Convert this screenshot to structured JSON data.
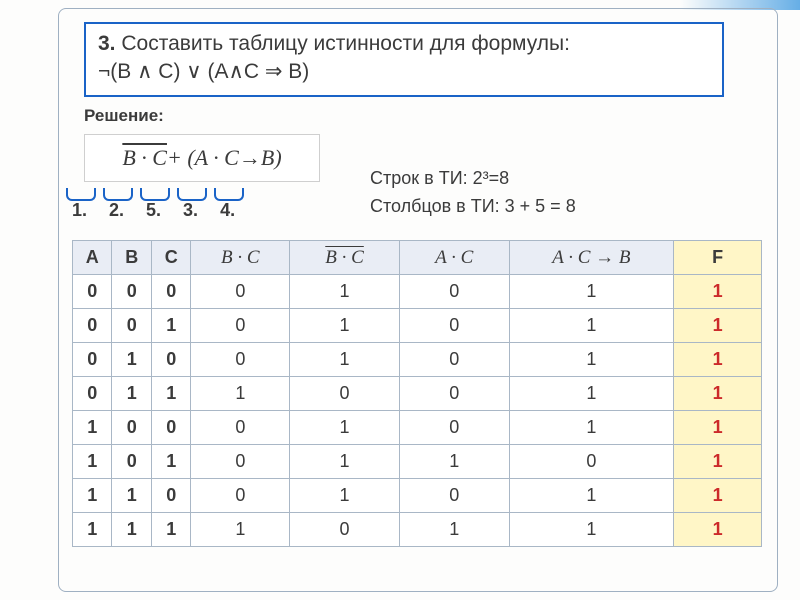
{
  "task": {
    "number_label": "3.",
    "text_line1": "Составить таблицу истинности для формулы:",
    "text_line2": "¬(B ∧ C) ∨ (A∧C ⇒ B)"
  },
  "solution_label": "Решение:",
  "formula_parts": {
    "bc": "B · C",
    "plus": " + (",
    "ac": "A · C",
    "arrow": " → ",
    "b": "B",
    "close": ")"
  },
  "steps": [
    "1.",
    "2.",
    "5.",
    "3.",
    "4."
  ],
  "info": {
    "rows": "Строк в ТИ: 2³=8",
    "cols": "Столбцов в ТИ: 3 + 5 = 8"
  },
  "headers": {
    "a": "A",
    "b": "B",
    "c": "C",
    "bc": "B · C",
    "nbc": "B · C",
    "ac": "A · C",
    "imp": "A · C → B",
    "f": "F"
  },
  "chart_data": {
    "type": "table",
    "title": "Таблица истинности",
    "columns": [
      "A",
      "B",
      "C",
      "B·C",
      "¬(B·C)",
      "A·C",
      "A·C→B",
      "F"
    ],
    "rows": [
      [
        0,
        0,
        0,
        0,
        1,
        0,
        1,
        1
      ],
      [
        0,
        0,
        1,
        0,
        1,
        0,
        1,
        1
      ],
      [
        0,
        1,
        0,
        0,
        1,
        0,
        1,
        1
      ],
      [
        0,
        1,
        1,
        1,
        0,
        0,
        1,
        1
      ],
      [
        1,
        0,
        0,
        0,
        1,
        0,
        1,
        1
      ],
      [
        1,
        0,
        1,
        0,
        1,
        1,
        0,
        1
      ],
      [
        1,
        1,
        0,
        0,
        1,
        0,
        1,
        1
      ],
      [
        1,
        1,
        1,
        1,
        0,
        1,
        1,
        1
      ]
    ]
  }
}
